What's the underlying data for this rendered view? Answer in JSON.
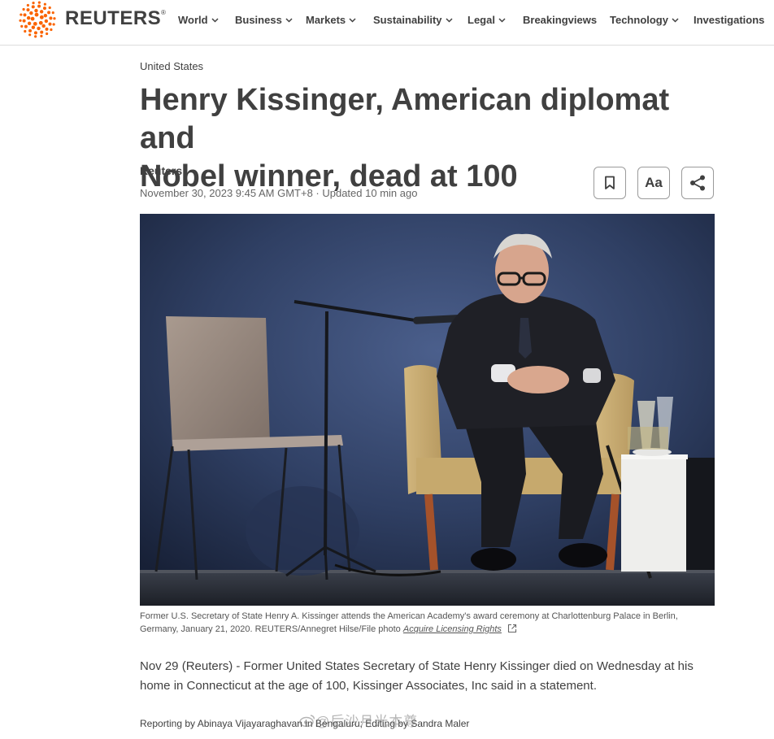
{
  "brand": {
    "name": "REUTERS",
    "registered": "®",
    "accent": "#fa6400"
  },
  "nav": [
    {
      "label": "World",
      "has_dropdown": true
    },
    {
      "label": "Business",
      "has_dropdown": true
    },
    {
      "label": "Markets",
      "has_dropdown": true
    },
    {
      "label": "Sustainability",
      "has_dropdown": true
    },
    {
      "label": "Legal",
      "has_dropdown": true
    },
    {
      "label": "Breakingviews",
      "has_dropdown": false
    },
    {
      "label": "Technology",
      "has_dropdown": true
    },
    {
      "label": "Investigations",
      "has_dropdown": false
    }
  ],
  "article": {
    "section": "United States",
    "headline_line1": "Henry Kissinger, American diplomat and",
    "headline_line2": "Nobel winner, dead at 100",
    "byline": "Reuters",
    "dateline": "November 30, 2023 9:45 AM GMT+8 · Updated 10 min ago",
    "tools": {
      "bookmark_icon": "bookmark-icon",
      "text_size_label": "Aa",
      "share_icon": "share-icon"
    },
    "caption_line1": "Former U.S. Secretary of State Henry A. Kissinger attends the American Academy's award ceremony at Charlottenburg Palace in Berlin,",
    "caption_line2": "Germany, January 21, 2020. REUTERS/Annegret Hilse/File photo",
    "licensing_link": "Acquire Licensing Rights",
    "body_line1": "Nov 29 (Reuters) - Former United States Secretary of State Henry Kissinger died on Wednesday at his",
    "body_line2": "home in Connecticut at the age of 100, Kissinger Associates, Inc said in a statement.",
    "credit": "Reporting by Abinaya Vijayaraghavan in Bengaluru; Editing by Sandra Maler"
  },
  "watermark": {
    "text": "@后沙月光本尊"
  }
}
